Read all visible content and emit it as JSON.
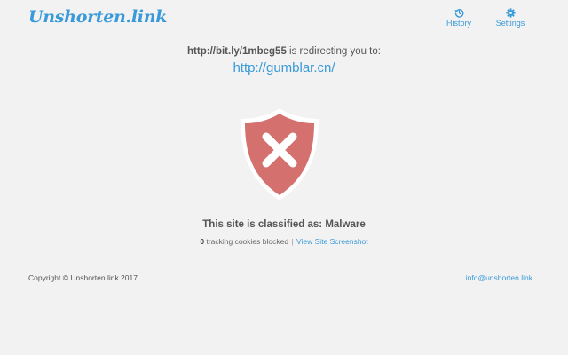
{
  "header": {
    "logo_text": "Unshorten.link",
    "nav": {
      "history_label": "History",
      "history_icon": "history-icon",
      "settings_label": "Settings",
      "settings_icon": "gear-icon"
    }
  },
  "redirect": {
    "short_url": "http://bit.ly/1mbeg55",
    "message": " is redirecting you to:",
    "destination_url": "http://gumblar.cn/"
  },
  "status": {
    "icon": "shield-x-icon",
    "shield_color": "#d4716f",
    "classification_text": "This site is classified as: Malware",
    "tracking_count": "0",
    "tracking_text": " tracking cookies blocked ",
    "separator": "|",
    "screenshot_link": " View Site Screenshot"
  },
  "footer": {
    "copyright": "Copyright © Unshorten.link 2017",
    "email": "info@unshorten.link"
  },
  "colors": {
    "accent": "#3a9ad9",
    "background": "#f2f2f2",
    "danger": "#d4716f"
  }
}
